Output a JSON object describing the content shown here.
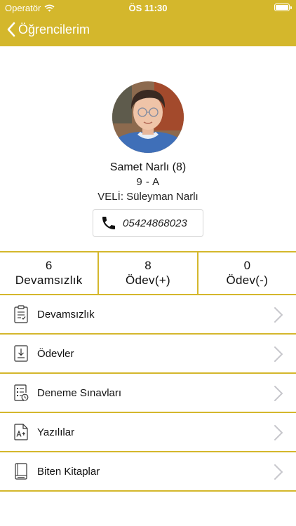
{
  "status_bar": {
    "carrier": "Operatör",
    "time": "ÖS 11:30"
  },
  "nav": {
    "back_label": "Öğrencilerim"
  },
  "student": {
    "name": "Samet Narlı (8)",
    "class": "9 - A",
    "parent": "VELİ: Süleyman Narlı",
    "phone": "05424868023"
  },
  "stats": [
    {
      "count": "6",
      "label": "Devamsızlık"
    },
    {
      "count": "8",
      "label": "Ödev(+)"
    },
    {
      "count": "0",
      "label": "Ödev(-)"
    }
  ],
  "menu": [
    {
      "label": "Devamsızlık",
      "icon": "clipboard-checklist-icon"
    },
    {
      "label": "Ödevler",
      "icon": "document-download-icon"
    },
    {
      "label": "Deneme Sınavları",
      "icon": "list-clock-icon"
    },
    {
      "label": "Yazılılar",
      "icon": "grade-aplus-icon"
    },
    {
      "label": "Biten Kitaplar",
      "icon": "book-icon"
    }
  ],
  "colors": {
    "accent": "#d4b72c",
    "header_text": "#ffffff"
  }
}
